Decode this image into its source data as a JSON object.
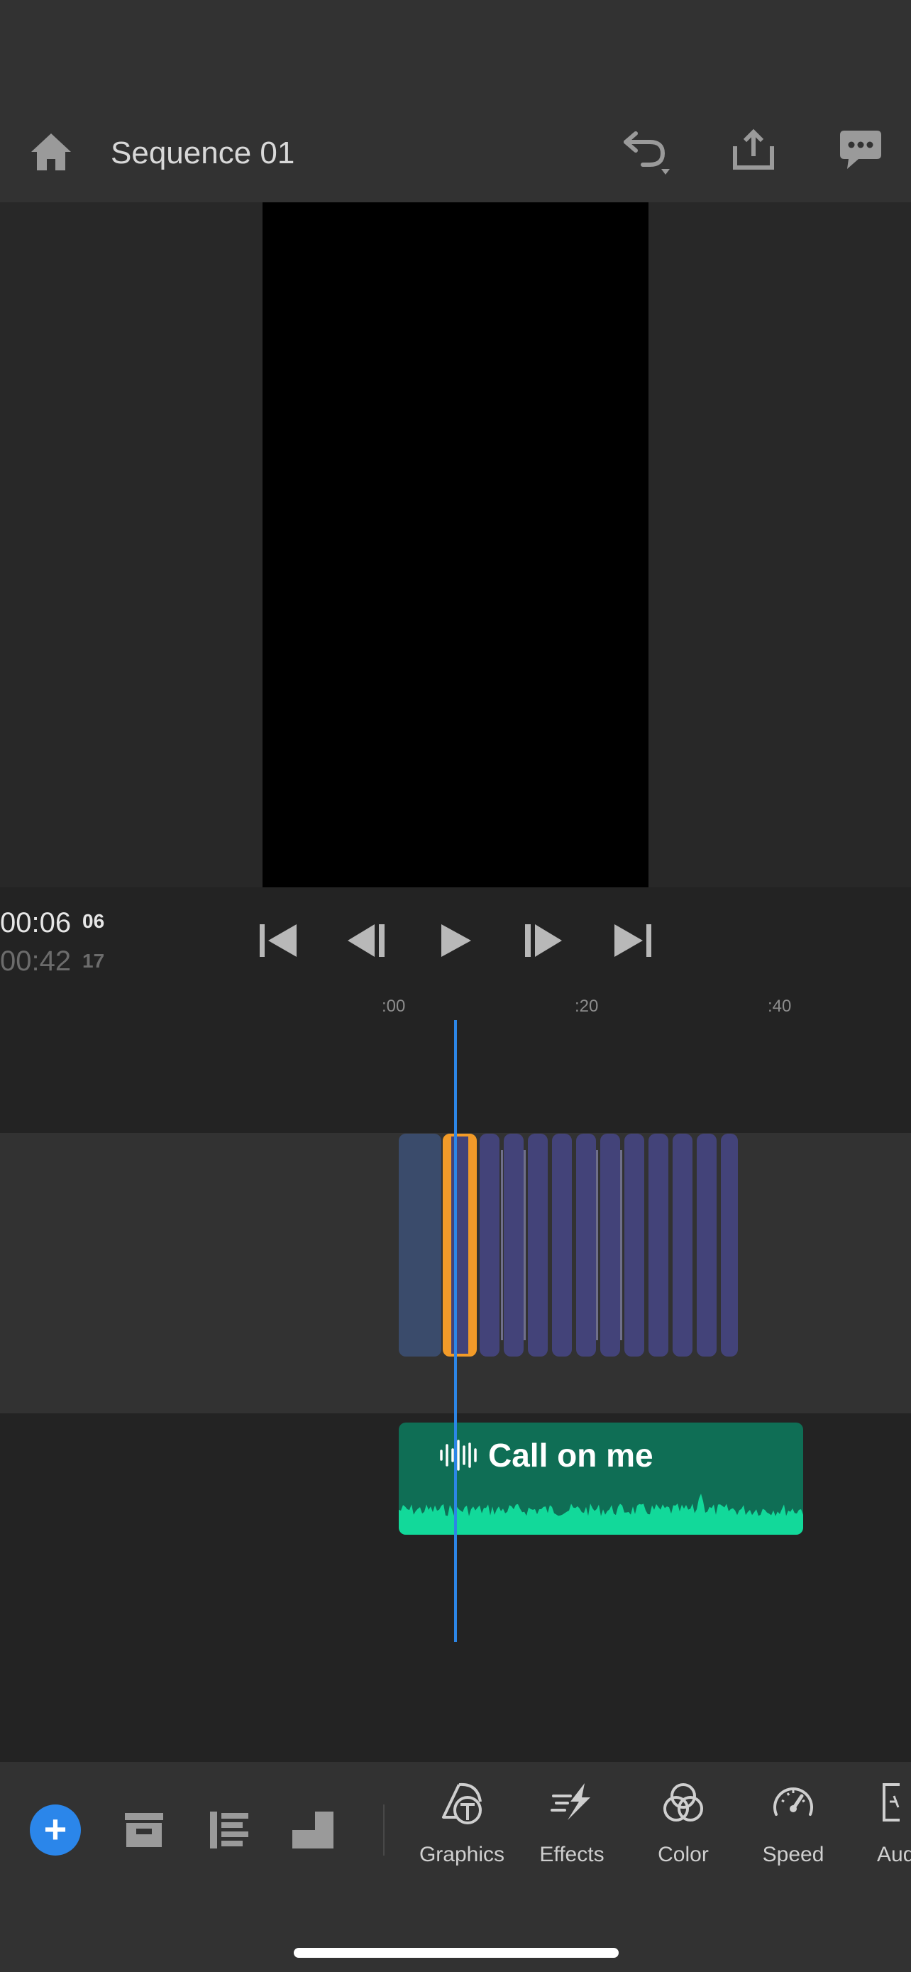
{
  "header": {
    "title": "Sequence 01",
    "home_icon": "home-icon",
    "undo_icon": "undo-icon",
    "share_icon": "share-icon",
    "feedback_icon": "feedback-icon"
  },
  "playback": {
    "current_time": "00:06",
    "current_frames": "06",
    "total_time": "00:42",
    "total_frames": "17"
  },
  "transport": [
    "skip-to-start-icon",
    "step-back-icon",
    "play-icon",
    "step-forward-icon",
    "skip-to-end-icon"
  ],
  "timeline": {
    "ruler": [
      ":00",
      ":20",
      ":40"
    ],
    "audio_clip_title": "Call on me"
  },
  "toolbar": {
    "tools": [
      {
        "label": "Graphics",
        "icon": "graphics-icon"
      },
      {
        "label": "Effects",
        "icon": "effects-icon"
      },
      {
        "label": "Color",
        "icon": "color-icon"
      },
      {
        "label": "Speed",
        "icon": "speed-icon"
      },
      {
        "label": "Audio",
        "icon": "audio-icon"
      }
    ]
  },
  "colors": {
    "accent_blue": "#2c86e6",
    "selection_orange": "#f39b27",
    "clip_purple": "#434379",
    "audio_green": "#0f6e55",
    "audio_wave": "#12d99a"
  }
}
